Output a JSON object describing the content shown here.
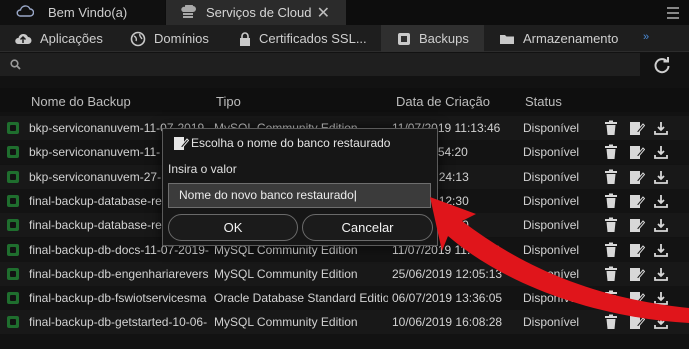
{
  "window_tabs": [
    {
      "label": "Bem Vindo(a)",
      "icon": "cloud-icon"
    },
    {
      "label": "Serviços de Cloud",
      "icon": "cloud-services-icon",
      "close": "✕"
    }
  ],
  "nav": [
    {
      "label": "Aplicações",
      "icon": "cloud-upload-icon"
    },
    {
      "label": "Domínios",
      "icon": "globe-icon"
    },
    {
      "label": "Certificados SSL...",
      "icon": "lock-icon"
    },
    {
      "label": "Backups",
      "icon": "backup-icon",
      "active": true
    },
    {
      "label": "Armazenamento",
      "icon": "folder-icon"
    }
  ],
  "nav_more": "»",
  "table": {
    "headers": [
      "Nome do Backup",
      "Tipo",
      "Data de Criação",
      "Status"
    ],
    "rows": [
      {
        "name": "bkp-serviconanuvem-11-07-2019-",
        "type": "MySQL Community Edition",
        "date": "11/07/2019 11:13:46",
        "status": "Disponível"
      },
      {
        "name": "bkp-serviconanuvem-11-",
        "type": "",
        "date": "2019 11:54:20",
        "status": "Disponível"
      },
      {
        "name": "bkp-serviconanuvem-27-",
        "type": "",
        "date": "2019 14:24:13",
        "status": "Disponível"
      },
      {
        "name": "final-backup-database-re",
        "type": "",
        "date": "2019 13:12:30",
        "status": "Disponível"
      },
      {
        "name": "final-backup-database-re",
        "type": "",
        "date": "2019 13:13:50",
        "status": "Disponível"
      },
      {
        "name": "final-backup-db-docs-11-07-2019-",
        "type": "MySQL Community Edition",
        "date": "11/07/2019 11:00:00",
        "status": "Disponível"
      },
      {
        "name": "final-backup-db-engenhariarevers",
        "type": "MySQL Community Edition",
        "date": "25/06/2019 12:05:13",
        "status": "Disponível"
      },
      {
        "name": "final-backup-db-fswiotservicesma",
        "type": "Oracle Database Standard Editio",
        "date": "06/07/2019 13:36:05",
        "status": "Disponível"
      },
      {
        "name": "final-backup-db-getstarted-10-06-",
        "type": "MySQL Community Edition",
        "date": "10/06/2019 16:08:28",
        "status": "Disponível"
      }
    ]
  },
  "dialog": {
    "title": "Escolha o nome do banco restaurado",
    "label": "Insira o valor",
    "input_value": "Nome do novo banco restaurado",
    "ok": "OK",
    "cancel": "Cancelar"
  },
  "colors": {
    "arrow": "#e0151b",
    "db_icon": "#1f6e2e"
  }
}
